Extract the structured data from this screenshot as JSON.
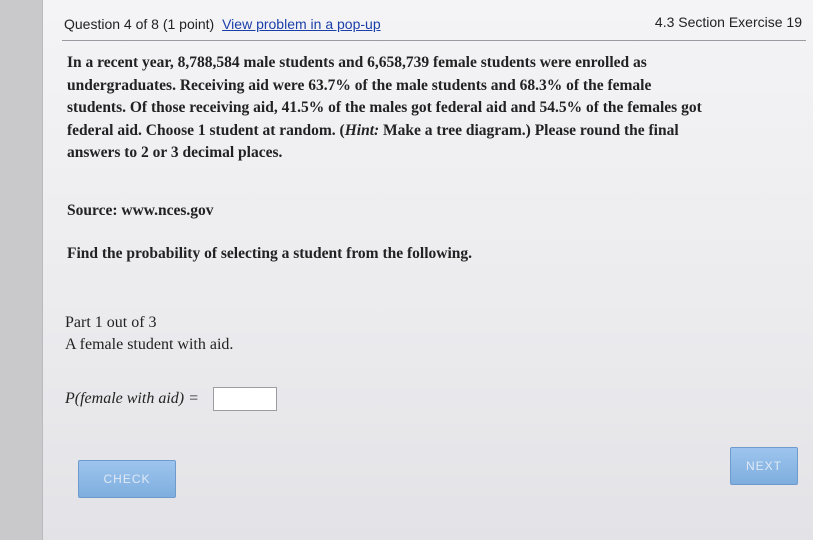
{
  "header": {
    "question_info": "Question 4 of 8 (1 point)",
    "popup_link": "View problem in a pop-up",
    "section": "4.3 Section Exercise 19"
  },
  "problem": {
    "line1": "In a recent year, 8,788,584 male students and 6,658,739 female students were enrolled as",
    "line2": "undergraduates. Receiving aid were 63.7% of the male students and 68.3% of the female",
    "line3": "students. Of those receiving aid, 41.5% of the males got federal aid and 54.5% of the females got",
    "line4_a": "federal aid. Choose 1 student at random. (",
    "line4_hint": "Hint:",
    "line4_b": " Make a tree diagram.) Please round the final",
    "line5": "answers to 2 or 3 decimal places."
  },
  "source": "Source: www.nces.gov",
  "find": "Find the probability of selecting a student from the following.",
  "part": {
    "title": "Part 1 out of 3",
    "prompt": "A female student with aid."
  },
  "answer": {
    "label": "P(female with aid) =",
    "value": ""
  },
  "buttons": {
    "check": "CHECK",
    "next": "NEXT"
  },
  "colors": {
    "link": "#1a3fa8",
    "button": "#8db8e6"
  }
}
